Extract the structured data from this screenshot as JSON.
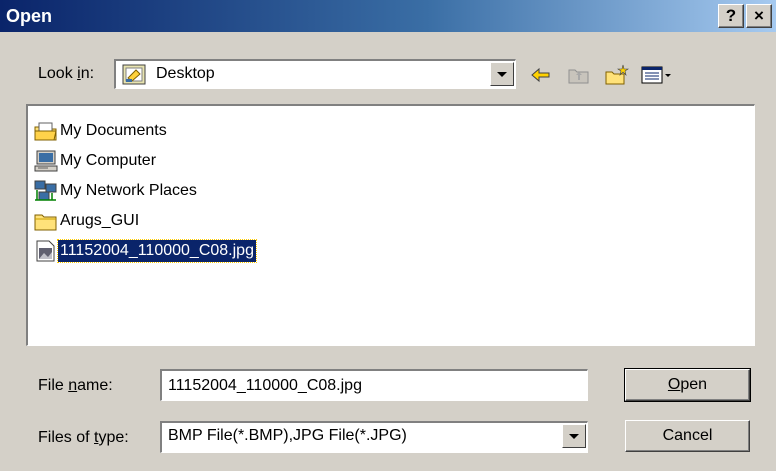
{
  "window": {
    "title": "Open",
    "help_label": "?",
    "close_label": "×"
  },
  "lookin": {
    "label_pre": "Look ",
    "label_accel": "i",
    "label_post": "n:",
    "value": "Desktop",
    "value_icon": "desktop-icon"
  },
  "toolbar": {
    "back_icon": "back-arrow-icon",
    "up_icon": "up-folder-icon",
    "new_folder_icon": "new-folder-icon",
    "view_menu_icon": "view-menu-icon"
  },
  "files": [
    {
      "name": "My Documents",
      "icon": "my-documents-icon"
    },
    {
      "name": "My Computer",
      "icon": "my-computer-icon"
    },
    {
      "name": "My Network Places",
      "icon": "network-places-icon"
    },
    {
      "name": "Arugs_GUI",
      "icon": "folder-icon"
    },
    {
      "name": "11152004_110000_C08.jpg",
      "icon": "image-file-icon",
      "selected": true
    }
  ],
  "filename": {
    "label_pre": "File ",
    "label_accel": "n",
    "label_post": "ame:",
    "value": "11152004_110000_C08.jpg"
  },
  "filetype": {
    "label_pre": "Files of ",
    "label_accel": "t",
    "label_post": "ype:",
    "value": "BMP File(*.BMP),JPG File(*.JPG)"
  },
  "buttons": {
    "open_accel": "O",
    "open_rest": "pen",
    "cancel": "Cancel"
  },
  "colors": {
    "title_active": "#0a246a",
    "face": "#d4d0c8",
    "selection": "#0a246a"
  }
}
